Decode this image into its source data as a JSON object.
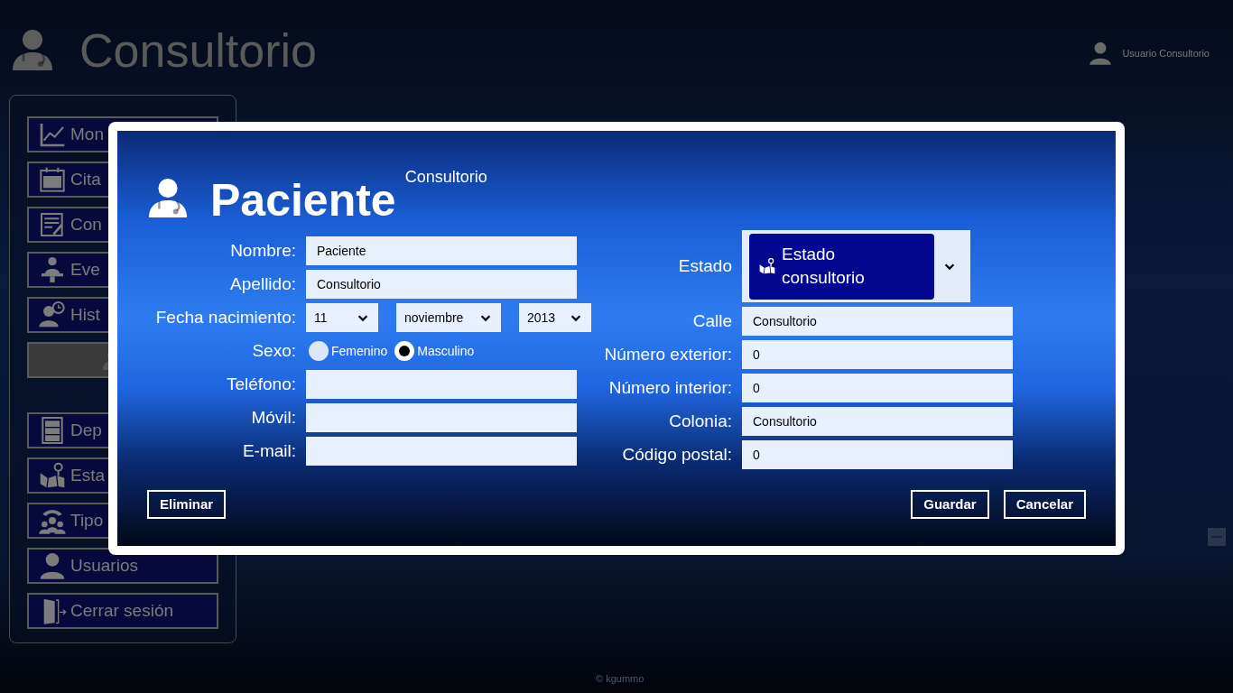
{
  "app": {
    "title": "Consultorio",
    "user": "Usuario Consultorio",
    "footer": "© kgummo"
  },
  "sidebar": {
    "groups": [
      [
        {
          "label": "Mon",
          "selected": false
        },
        {
          "label": "Cita",
          "selected": false
        },
        {
          "label": "Con",
          "selected": false
        },
        {
          "label": "Eve",
          "selected": false
        },
        {
          "label": "Hist",
          "selected": false
        },
        {
          "selected": true
        }
      ],
      [
        {
          "label": "Dep",
          "selected": false
        },
        {
          "label": "Esta",
          "selected": false
        },
        {
          "label": "Tipo",
          "selected": false
        },
        {
          "label": "Usuarios",
          "selected": false
        },
        {
          "label": "Cerrar sesión",
          "selected": false
        }
      ]
    ]
  },
  "dialog": {
    "title": "Paciente",
    "subtitle": "Consultorio",
    "left_fields": [
      {
        "kind": "text",
        "label": "Nombre:",
        "value": "Paciente"
      },
      {
        "kind": "text",
        "label": "Apellido:",
        "value": "Consultorio"
      },
      {
        "kind": "date",
        "label": "Fecha nacimiento:",
        "day": "11",
        "month": "noviembre",
        "year": "2013"
      },
      {
        "kind": "radio",
        "label": "Sexo:",
        "options": [
          {
            "label": "Femenino",
            "selected": false
          },
          {
            "label": "Masculino",
            "selected": true
          }
        ]
      },
      {
        "kind": "text",
        "label": "Teléfono:"
      },
      {
        "kind": "text",
        "label": "Móvil:"
      },
      {
        "kind": "text",
        "label": "E-mail:"
      }
    ],
    "estado": {
      "label": "Estado",
      "value": "Estado consultorio"
    },
    "right_fields": [
      {
        "label": "Calle",
        "value": "Consultorio"
      },
      {
        "label": "Número exterior:",
        "value": "0"
      },
      {
        "label": "Número interior:",
        "value": "0"
      },
      {
        "label": "Colonia:",
        "value": "Consultorio"
      },
      {
        "label": "Código postal:",
        "value": "0"
      }
    ],
    "buttons": {
      "left": [
        "Eliminar"
      ],
      "right": [
        "Guardar",
        "Cancelar"
      ]
    }
  }
}
